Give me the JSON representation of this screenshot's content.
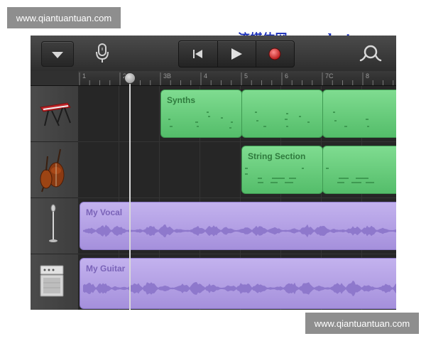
{
  "watermarks": {
    "top": "www.qiantuantuan.com",
    "bottom": "www.qiantuantuan.com",
    "blue": "流媒体网 www.lmtw.com"
  },
  "toolbar": {
    "icons": [
      "chevron-down-icon",
      "microphone-icon",
      "rewind-icon",
      "play-icon",
      "record-icon",
      "loop-icon"
    ]
  },
  "ruler": {
    "bars": [
      "1",
      "2",
      "3B",
      "4",
      "5",
      "6",
      "7C",
      "8"
    ]
  },
  "tracks": [
    {
      "instrument": "keyboard-synth",
      "icon": "keyboard-icon"
    },
    {
      "instrument": "strings",
      "icon": "violin-icon"
    },
    {
      "instrument": "vocal",
      "icon": "microphone-stand-icon"
    },
    {
      "instrument": "guitar",
      "icon": "amplifier-icon"
    }
  ],
  "regions": {
    "synths": "Synths",
    "string_section": "String Section",
    "my_vocal": "My Vocal",
    "my_guitar": "My Guitar"
  },
  "colors": {
    "midi_region": "#6ccc7e",
    "audio_region": "#b4a2e6",
    "record": "#d42a2a"
  }
}
